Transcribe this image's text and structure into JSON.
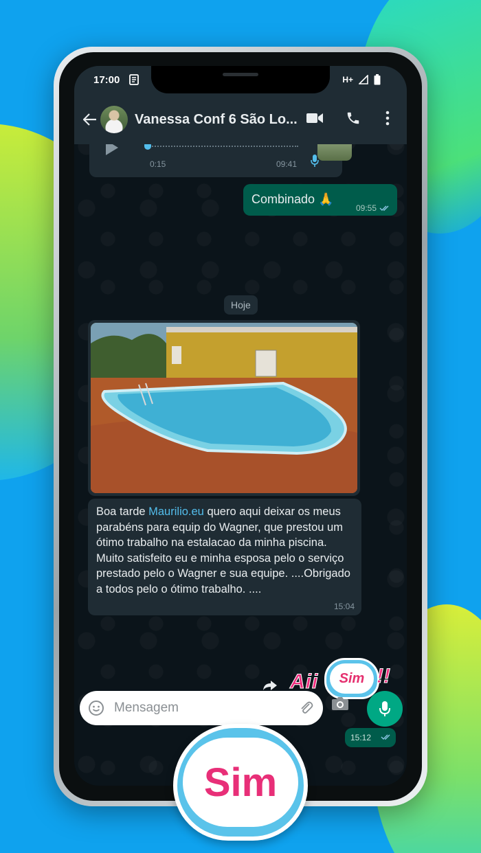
{
  "status_bar": {
    "time": "17:00",
    "network": "H+"
  },
  "header": {
    "contact_name": "Vanessa Conf 6 São Lo..."
  },
  "messages": {
    "voice": {
      "duration": "0:15",
      "time": "09:41"
    },
    "combinado": {
      "text": "Combinado 🙏",
      "time": "09:55"
    },
    "date_chip": "Hoje",
    "testimonial": {
      "text_before": "Boa tarde ",
      "link": "Maurilio.eu",
      "text_after": " quero aqui deixar os meus parabéns para equip  do Wagner, que prestou um ótimo trabalho na estalacao da minha piscina. Muito satisfeito eu e minha esposa pelo o serviço prestado pelo o Wagner e sua equipe. ....Obrigado a todos pelo o ótimo trabalho. ....",
      "time": "15:04"
    },
    "sticker": {
      "aii": "Aii",
      "sim": "Sim",
      "exclamation": "!!"
    },
    "last_time": "15:12"
  },
  "input": {
    "placeholder": "Mensagem"
  },
  "overlay": {
    "sim_label": "Sim"
  },
  "colors": {
    "accent": "#00a884",
    "outgoing_bubble": "#005c4b",
    "incoming_bubble": "#1f2c34",
    "link": "#53bdeb",
    "sticker_pink": "#ee2c7d"
  }
}
